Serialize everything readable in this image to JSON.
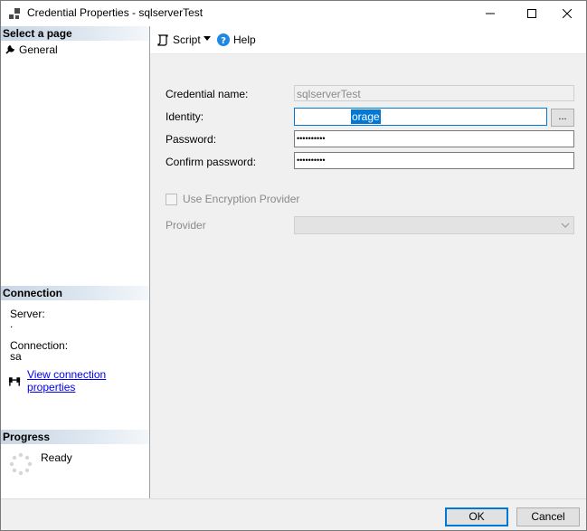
{
  "window": {
    "title": "Credential Properties - sqlserverTest"
  },
  "left_pane": {
    "select_page_header": "Select a page",
    "pages": [
      {
        "label": "General",
        "icon": "wrench-icon"
      }
    ],
    "connection_header": "Connection",
    "server_label": "Server:",
    "server_value": ".",
    "connection_label": "Connection:",
    "connection_value": "sa",
    "view_connection_link": "View connection properties",
    "progress_header": "Progress",
    "progress_status": "Ready"
  },
  "toolbar": {
    "script_label": "Script",
    "help_label": "Help"
  },
  "form": {
    "credential_name_label": "Credential name:",
    "credential_name_value": "sqlserverTest",
    "identity_label": "Identity:",
    "identity_value_selected": "orage",
    "password_label": "Password:",
    "password_value": "••••••••••",
    "confirm_password_label": "Confirm password:",
    "confirm_password_value": "••••••••••",
    "ellipsis_label": "...",
    "use_encryption_label": "Use Encryption Provider",
    "use_encryption_checked": false,
    "provider_label": "Provider",
    "provider_value": ""
  },
  "buttons": {
    "ok_label": "OK",
    "cancel_label": "Cancel"
  },
  "colors": {
    "accent": "#0078d7",
    "link": "#0000ee",
    "help_icon": "#1e88e5"
  }
}
